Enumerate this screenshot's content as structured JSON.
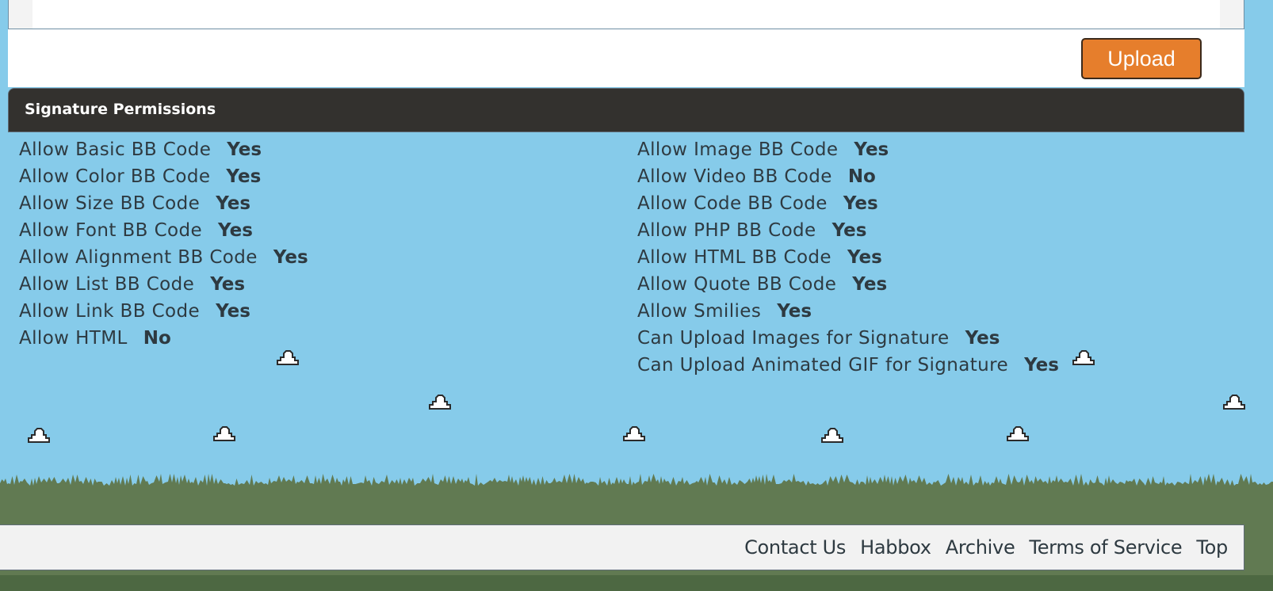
{
  "upload": {
    "button_label": "Upload"
  },
  "permissions": {
    "title": "Signature Permissions",
    "left": [
      {
        "label": "Allow Basic BB Code",
        "value": "Yes"
      },
      {
        "label": "Allow Color BB Code",
        "value": "Yes"
      },
      {
        "label": "Allow Size BB Code",
        "value": "Yes"
      },
      {
        "label": "Allow Font BB Code",
        "value": "Yes"
      },
      {
        "label": "Allow Alignment BB Code",
        "value": "Yes"
      },
      {
        "label": "Allow List BB Code",
        "value": "Yes"
      },
      {
        "label": "Allow Link BB Code",
        "value": "Yes"
      },
      {
        "label": "Allow HTML",
        "value": "No"
      }
    ],
    "right": [
      {
        "label": "Allow Image BB Code",
        "value": "Yes"
      },
      {
        "label": "Allow Video BB Code",
        "value": "No"
      },
      {
        "label": "Allow Code BB Code",
        "value": "Yes"
      },
      {
        "label": "Allow PHP BB Code",
        "value": "Yes"
      },
      {
        "label": "Allow HTML BB Code",
        "value": "Yes"
      },
      {
        "label": "Allow Quote BB Code",
        "value": "Yes"
      },
      {
        "label": "Allow Smilies",
        "value": "Yes"
      },
      {
        "label": "Can Upload Images for Signature",
        "value": "Yes"
      },
      {
        "label": "Can Upload Animated GIF for Signature",
        "value": "Yes"
      }
    ]
  },
  "footer": {
    "links": [
      "Contact Us",
      "Habbox",
      "Archive",
      "Terms of Service",
      "Top"
    ]
  },
  "colors": {
    "sky": "#86cbea",
    "header_bg": "#33312e",
    "accent": "#e67e2c",
    "trees": "#617a52",
    "footer_bg": "#f2f2f2"
  }
}
